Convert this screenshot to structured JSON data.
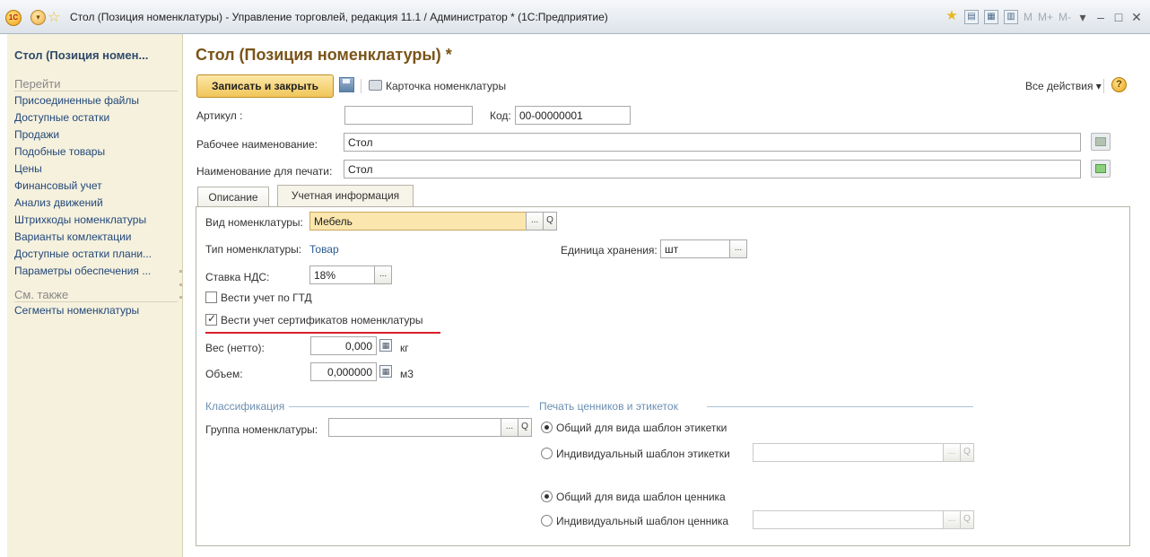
{
  "window": {
    "title": "Стол (Позиция номенклатуры) - Управление торговлей, редакция 11.1 / Администратор * (1С:Предприятие)",
    "logo": "1C",
    "memory_buttons": [
      "M",
      "M+",
      "M-"
    ]
  },
  "sidebar": {
    "title": "Стол (Позиция номен...",
    "section_go": "Перейти",
    "items": [
      "Присоединенные файлы",
      "Доступные остатки",
      "Продажи",
      "Подобные товары",
      "Цены",
      "Финансовый учет",
      "Анализ движений",
      "Штрихкоды номенклатуры",
      "Варианты комлектации",
      "Доступные остатки плани...",
      "Параметры обеспечения ..."
    ],
    "section_see_also": "См. также",
    "see_also_items": [
      "Сегменты номенклатуры"
    ]
  },
  "form": {
    "title": "Стол (Позиция номенклатуры) *",
    "save_close_label": "Записать и закрыть",
    "card_label": "Карточка номенклатуры",
    "all_actions_label": "Все действия ▾",
    "help": "?",
    "article_label": "Артикул :",
    "article_value": "",
    "code_label": "Код:",
    "code_value": "00-00000001",
    "work_name_label": "Рабочее наименование:",
    "work_name_value": "Стол",
    "print_name_label": "Наименование для печати:",
    "print_name_value": "Стол"
  },
  "tabs": [
    {
      "label": "Описание",
      "active": false
    },
    {
      "label": "Учетная информация",
      "active": true
    }
  ],
  "accounting": {
    "kind_label": "Вид номенклатуры:",
    "kind_value": "Мебель",
    "type_label": "Тип номенклатуры:",
    "type_value": "Товар",
    "unit_label": "Единица хранения:",
    "unit_value": "шт",
    "vat_label": "Ставка НДС:",
    "vat_value": "18%",
    "gtd_label": "Вести учет по ГТД",
    "gtd_checked": false,
    "cert_label": "Вести учет сертификатов номенклатуры",
    "cert_checked": true,
    "weight_label": "Вес (нетто):",
    "weight_value": "0,000",
    "weight_unit": "кг",
    "volume_label": "Объем:",
    "volume_value": "0,000000",
    "volume_unit": "м3"
  },
  "classification": {
    "title": "Классификация",
    "group_label": "Группа номенклатуры:",
    "group_value": ""
  },
  "printing": {
    "title": "Печать ценников и этикеток",
    "label_common": "Общий для вида шаблон этикетки",
    "label_individual": "Индивидуальный шаблон этикетки",
    "label_selected": "common",
    "price_common": "Общий для вида шаблон ценника",
    "price_individual": "Индивидуальный шаблон ценника",
    "price_selected": "common"
  },
  "ui": {
    "ellipsis": "...",
    "search": "Q"
  }
}
